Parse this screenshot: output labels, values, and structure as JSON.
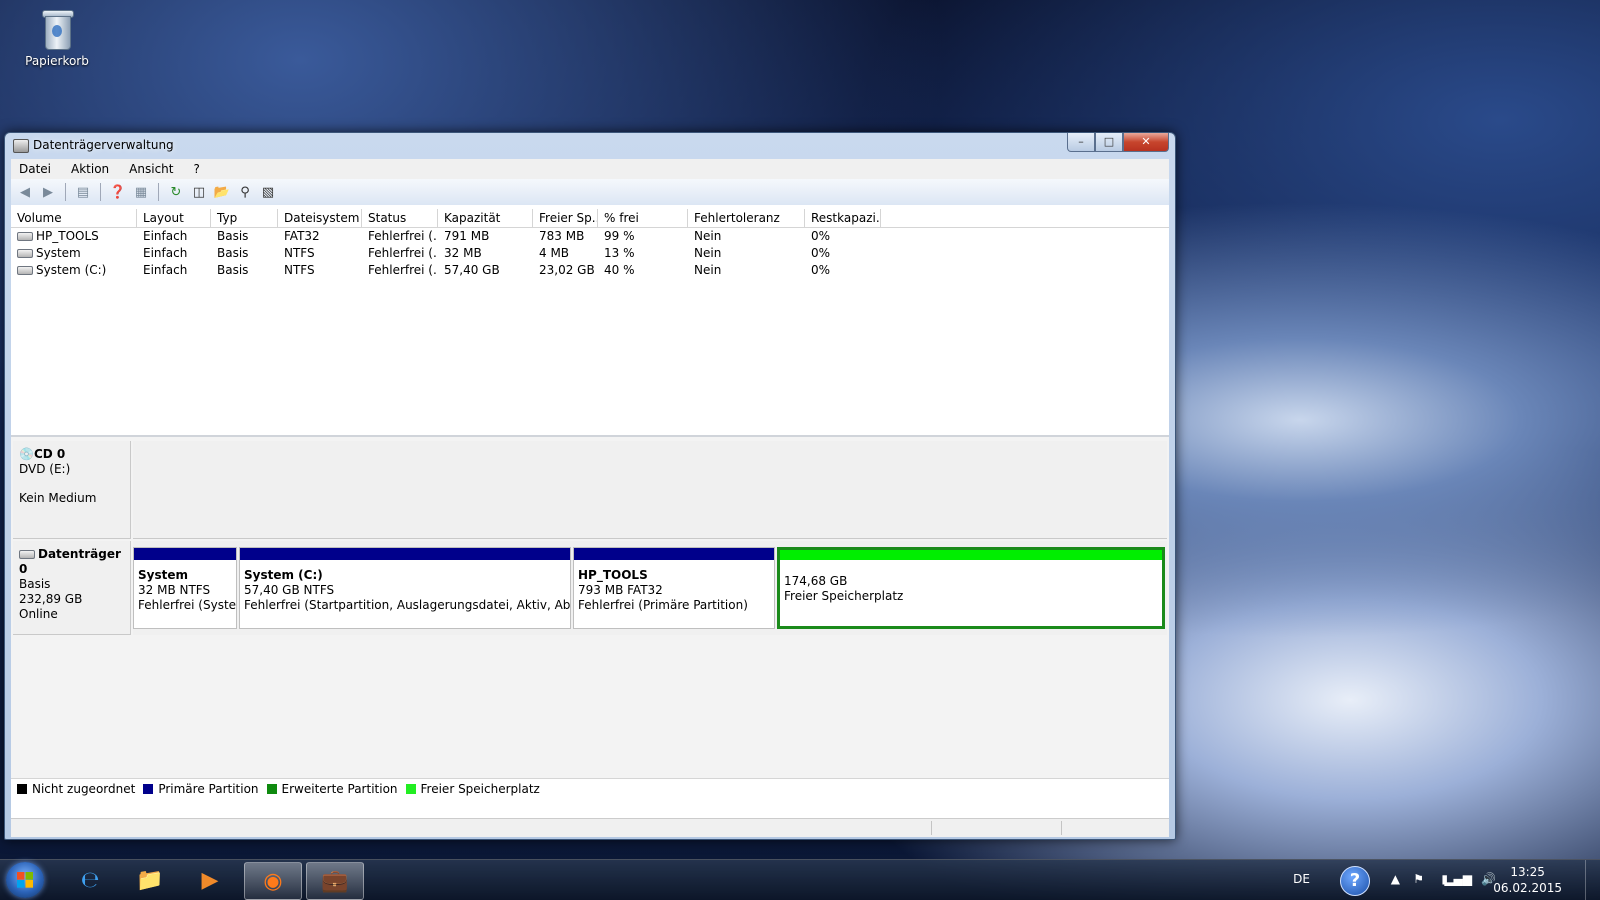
{
  "desktop": {
    "recycle_bin_label": "Papierkorb"
  },
  "window": {
    "title": "Datenträgerverwaltung",
    "controls": {
      "minimize": "–",
      "maximize": "□",
      "close": "✕"
    }
  },
  "menu": [
    "Datei",
    "Aktion",
    "Ansicht",
    "?"
  ],
  "toolbar_icons": [
    "back-icon",
    "forward-icon",
    "console-tree-icon",
    "help-icon",
    "properties-icon",
    "refresh-icon",
    "rescan-icon",
    "open-icon",
    "search-icon",
    "export-icon"
  ],
  "volume_list": {
    "columns": [
      "Volume",
      "Layout",
      "Typ",
      "Dateisystem",
      "Status",
      "Kapazität",
      "Freier Sp...",
      "% frei",
      "Fehlertoleranz",
      "Restkapazi..."
    ],
    "rows": [
      [
        "HP_TOOLS",
        "Einfach",
        "Basis",
        "FAT32",
        "Fehlerfrei (...",
        "791 MB",
        "783 MB",
        "99 %",
        "Nein",
        "0%"
      ],
      [
        "System",
        "Einfach",
        "Basis",
        "NTFS",
        "Fehlerfrei (...",
        "32 MB",
        "4 MB",
        "13 %",
        "Nein",
        "0%"
      ],
      [
        "System (C:)",
        "Einfach",
        "Basis",
        "NTFS",
        "Fehlerfrei (...",
        "57,40 GB",
        "23,02 GB",
        "40 %",
        "Nein",
        "0%"
      ]
    ]
  },
  "disks": {
    "cd0": {
      "name": "CD 0",
      "type": "DVD (E:)",
      "media": "Kein Medium"
    },
    "disk0": {
      "name": "Datenträger 0",
      "type": "Basis",
      "size": "232,89 GB",
      "status": "Online",
      "partitions": [
        {
          "title": "System",
          "size": "32 MB NTFS",
          "status": "Fehlerfrei (System"
        },
        {
          "title": "System  (C:)",
          "size": "57,40 GB NTFS",
          "status": "Fehlerfrei (Startpartition, Auslagerungsdatei, Aktiv, Absturzabb"
        },
        {
          "title": "HP_TOOLS",
          "size": "793 MB FAT32",
          "status": "Fehlerfrei (Primäre Partition)"
        },
        {
          "title": "",
          "size": "174,68 GB",
          "status": "Freier Speicherplatz"
        }
      ]
    }
  },
  "legend": [
    {
      "label": "Nicht zugeordnet",
      "color": "#000000"
    },
    {
      "label": "Primäre Partition",
      "color": "#00008b"
    },
    {
      "label": "Erweiterte Partition",
      "color": "#0f8a0f"
    },
    {
      "label": "Freier Speicherplatz",
      "color": "#22ee22"
    }
  ],
  "taskbar": {
    "apps": [
      "internet-explorer-icon",
      "file-explorer-icon",
      "media-player-icon",
      "firefox-icon",
      "disk-management-icon"
    ],
    "language": "DE",
    "help": "?",
    "time": "13:25",
    "date": "06.02.2015"
  }
}
